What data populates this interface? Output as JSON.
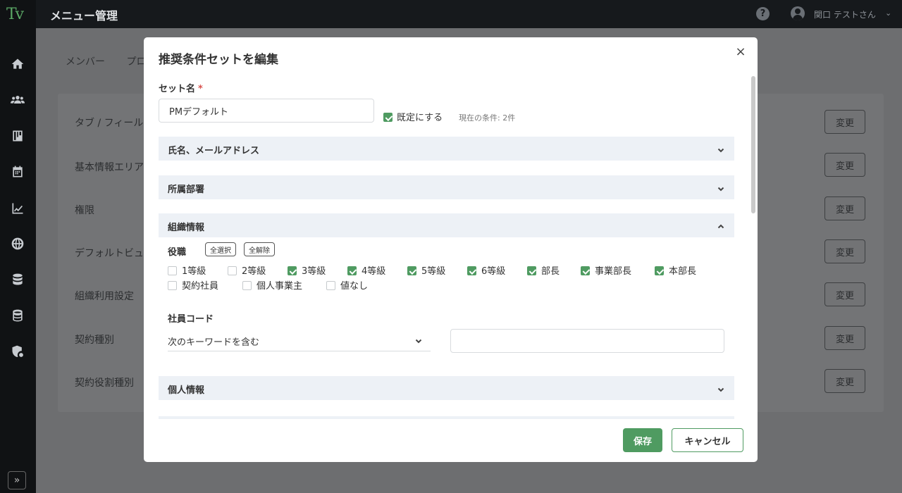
{
  "app": {
    "logo_text": "Tv",
    "title": "メニュー管理",
    "user_name": "関口 テストさん"
  },
  "sidebar": {
    "icons": [
      "home-icon",
      "people-icon",
      "board-icon",
      "calendar-icon",
      "chart-icon",
      "globe-icon",
      "database-icon",
      "database-alt-icon",
      "shield-gear-icon"
    ],
    "expand_label": "»"
  },
  "background": {
    "tabs": [
      "メンバー",
      "プロ"
    ],
    "rows": [
      {
        "label": "タブ / フィール",
        "button": "変更"
      },
      {
        "label": "基本情報エリア",
        "button": "変更"
      },
      {
        "label": "権限",
        "button": "変更"
      },
      {
        "label": "デフォルトビュ",
        "button": "変更"
      },
      {
        "label": "組織利用設定",
        "button": "変更"
      },
      {
        "label": "契約種別",
        "button": "変更"
      },
      {
        "label": "契約役割種別",
        "button": "変更"
      }
    ]
  },
  "modal": {
    "title": "推奨条件セットを編集",
    "close_label": "×",
    "set_name_label": "セット名",
    "required_mark": "*",
    "set_name_value": "PMデフォルト",
    "default_label": "既定にする",
    "default_checked": true,
    "condition_count": "現在の条件: 2件",
    "sections": [
      {
        "title": "氏名、メールアドレス",
        "expanded": false
      },
      {
        "title": "所属部署",
        "expanded": false
      },
      {
        "title": "組織情報",
        "expanded": true
      },
      {
        "title": "個人情報",
        "expanded": false
      }
    ],
    "position": {
      "label": "役職",
      "select_all": "全選択",
      "clear_all": "全解除",
      "options": [
        {
          "label": "1等級",
          "checked": false
        },
        {
          "label": "2等級",
          "checked": false
        },
        {
          "label": "3等級",
          "checked": true
        },
        {
          "label": "4等級",
          "checked": true
        },
        {
          "label": "5等級",
          "checked": true
        },
        {
          "label": "6等級",
          "checked": true
        },
        {
          "label": "部長",
          "checked": true
        },
        {
          "label": "事業部長",
          "checked": true
        },
        {
          "label": "本部長",
          "checked": true
        },
        {
          "label": "契約社員",
          "checked": false
        },
        {
          "label": "個人事業主",
          "checked": false
        },
        {
          "label": "値なし",
          "checked": false
        }
      ]
    },
    "employee_code": {
      "label": "社員コード",
      "match_mode": "次のキーワードを含む",
      "keyword_value": ""
    },
    "save_label": "保存",
    "cancel_label": "キャンセル"
  },
  "colors": {
    "accent": "#4f9b61",
    "section_bg": "#edf1f6",
    "sidebar_bg": "#101214"
  }
}
